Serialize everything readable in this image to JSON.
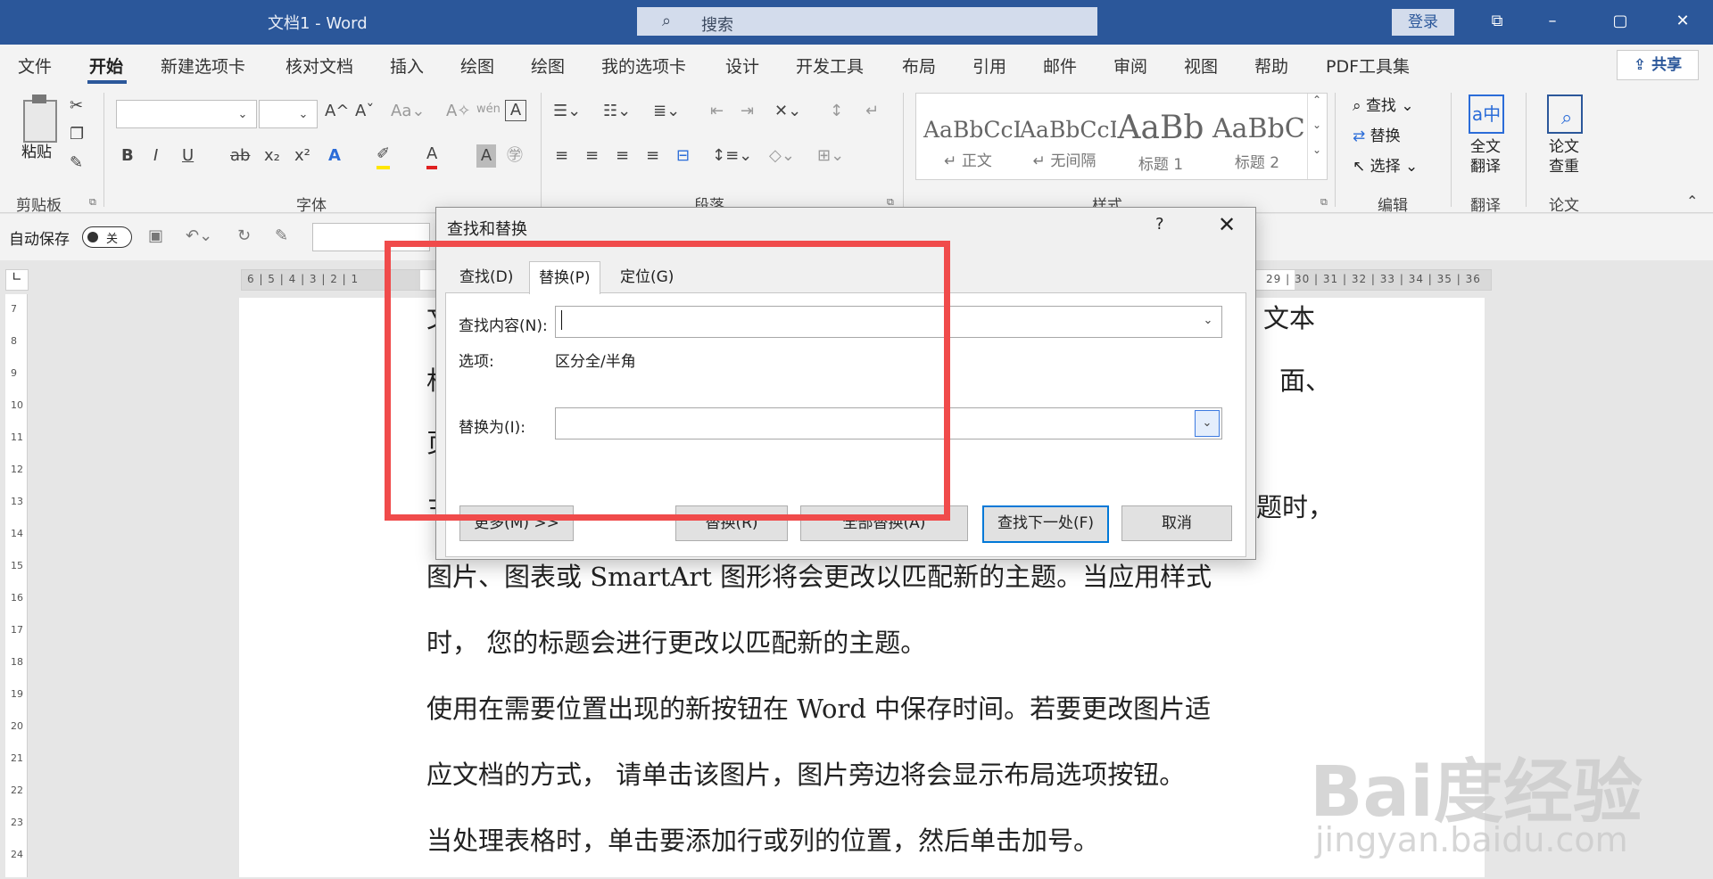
{
  "window": {
    "title": "文档1  -  Word",
    "search_placeholder": "搜索",
    "login_label": "登录",
    "controls": [
      "⧉",
      "–",
      "▢",
      "✕"
    ]
  },
  "tabs": [
    "文件",
    "开始",
    "新建选项卡",
    "核对文档",
    "插入",
    "绘图",
    "绘图",
    "我的选项卡",
    "设计",
    "开发工具",
    "布局",
    "引用",
    "邮件",
    "审阅",
    "视图",
    "帮助",
    "PDF工具集"
  ],
  "active_tab": "开始",
  "share_label": "共享",
  "ribbon": {
    "clipboard": {
      "paste_label": "粘贴",
      "group_label": "剪贴板"
    },
    "font": {
      "group_label": "字体",
      "buttons": [
        "B",
        "I",
        "U",
        "ab",
        "x₂",
        "x²"
      ]
    },
    "paragraph": {
      "group_label": "段落"
    },
    "styles": {
      "group_label": "样式",
      "items": [
        {
          "sample": "AaBbCcI",
          "name": "↵ 正文"
        },
        {
          "sample": "AaBbCcI",
          "name": "↵ 无间隔"
        },
        {
          "sample": "AaBb",
          "name": "标题 1"
        },
        {
          "sample": "AaBbC",
          "name": "标题 2"
        }
      ]
    },
    "editing": {
      "group_label": "编辑",
      "find": "查找",
      "replace": "替换",
      "select": "选择"
    },
    "translate": {
      "group_label": "翻译",
      "button": "全文\n翻译"
    },
    "thesis": {
      "group_label": "论文",
      "button": "论文\n查重"
    }
  },
  "qat": {
    "autosave_label": "自动保存",
    "toggle_label": "关"
  },
  "ruler": {
    "h_numbers": "6 | 5 | 4 | 3 | 2 | 1",
    "h_numbers_right": "29 | 30 | 31 | 32 | 33 | 34 | 35 | 36",
    "v_numbers": [
      "7",
      "8",
      "9",
      "10",
      "11",
      "12",
      "13",
      "14",
      "15",
      "16",
      "17",
      "18",
      "19",
      "20",
      "21",
      "22",
      "23",
      "24"
    ]
  },
  "document": {
    "partial_lines": [
      {
        "left": "文",
        "right": "文本"
      },
      {
        "left": "机",
        "right": "面、"
      },
      {
        "left": "页",
        "right": ""
      },
      {
        "left": "主",
        "right": "题时，"
      }
    ],
    "lines": [
      "图片、图表或 SmartArt 图形将会更改以匹配新的主题。当应用样式",
      "时，     您的标题会进行更改以匹配新的主题。",
      "使用在需要位置出现的新按钮在 Word 中保存时间。若要更改图片适",
      "应文档的方式，    请单击该图片，图片旁边将会显示布局选项按钮。",
      "当处理表格时，单击要添加行或列的位置，然后单击加号。"
    ]
  },
  "dialog": {
    "title": "查找和替换",
    "help": "?",
    "close": "✕",
    "tabs": [
      "查找(D)",
      "替换(P)",
      "定位(G)"
    ],
    "active_tab": "替换(P)",
    "find_label": "查找内容(N):",
    "find_value": "",
    "options_label": "选项:",
    "options_value": "区分全/半角",
    "replace_label": "替换为(I):",
    "replace_value": "",
    "buttons": {
      "more": "更多(M) >>",
      "replace": "替换(R)",
      "replace_all": "全部替换(A)",
      "find_next": "查找下一处(F)",
      "cancel": "取消"
    }
  },
  "watermark": {
    "main": "Bai度经验",
    "sub": "jingyan.baidu.com"
  },
  "colors": {
    "title_bar": "#2b579a",
    "highlight_box": "#f04b4b",
    "accent": "#0078d7"
  }
}
